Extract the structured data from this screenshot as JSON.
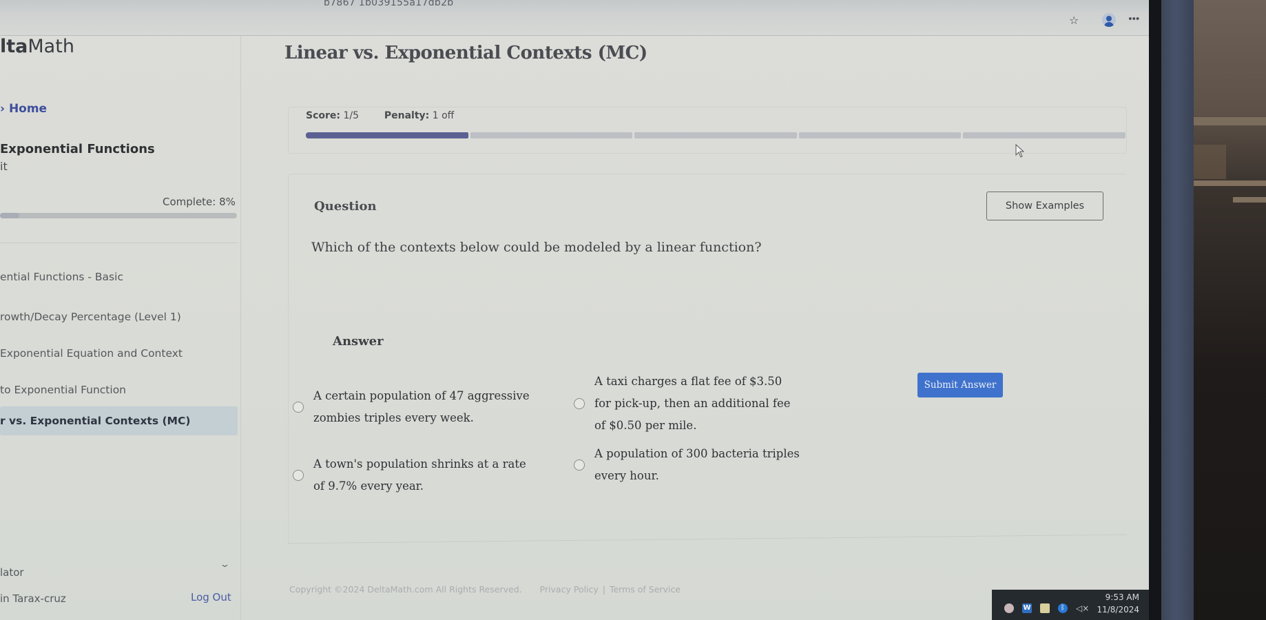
{
  "browser": {
    "url_fragment": "b7867 1b039155a17db2b",
    "icons": [
      "star-icon",
      "profile-icon",
      "kebab-menu-icon"
    ]
  },
  "sidebar": {
    "brand_prefix": "lta",
    "brand_suffix": "Math",
    "home_link": "Home",
    "unit_title": "Exponential Functions",
    "exit_link": "it",
    "complete_label": "Complete: 8%",
    "complete_percent": 8,
    "items": [
      {
        "label": "ential Functions - Basic",
        "active": false
      },
      {
        "label": "rowth/Decay Percentage (Level 1)",
        "active": false
      },
      {
        "label": " Exponential Equation and Context",
        "active": false
      },
      {
        "label": "to Exponential Function",
        "active": false
      },
      {
        "label": "r vs. Exponential Contexts (MC)",
        "active": true
      }
    ],
    "calculator_label": "lator",
    "user_label": "in Tarax-cruz",
    "logout_label": "Log Out"
  },
  "main": {
    "title": "Linear vs. Exponential Contexts (MC)",
    "score_label": "Score:",
    "score_value": "1/5",
    "penalty_label": "Penalty:",
    "penalty_value": "1 off",
    "score_segments_total": 5,
    "score_segments_filled": 1,
    "question_label": "Question",
    "show_examples_label": "Show Examples",
    "question_text": "Which of the contexts below could be modeled by a linear function?",
    "answer_label": "Answer",
    "choices": [
      {
        "text": "A certain population of 47 aggressive zombies triples every week.",
        "selected": false
      },
      {
        "text": "A taxi charges a flat fee of $3.50 for pick-up, then an additional fee of $0.50 per mile.",
        "selected": false
      },
      {
        "text": "A town's population shrinks at a rate of 9.7% every year.",
        "selected": false
      },
      {
        "text": "A population of 300 bacteria triples every hour.",
        "selected": false
      }
    ],
    "submit_label": "Submit Answer"
  },
  "footer": {
    "copyright": "Copyright ©2024 DeltaMath.com All Rights Reserved.",
    "privacy": "Privacy Policy",
    "separator": "|",
    "terms": "Terms of Service"
  },
  "taskbar": {
    "tray_icons": [
      "chrome-icon",
      "word-icon",
      "microsoft-store-icon",
      "bluetooth-icon",
      "volume-muted-icon"
    ],
    "word_letter": "W",
    "bt_glyph": "ᛒ",
    "volume_glyph": "◁×",
    "time": "9:53 AM",
    "date": "11/8/2024"
  },
  "colors": {
    "accent_blue": "#3f72cc",
    "score_bar_fill": "#5b6093",
    "link_blue": "#3e4e9c",
    "active_nav_bg": "#c3cfd3"
  }
}
